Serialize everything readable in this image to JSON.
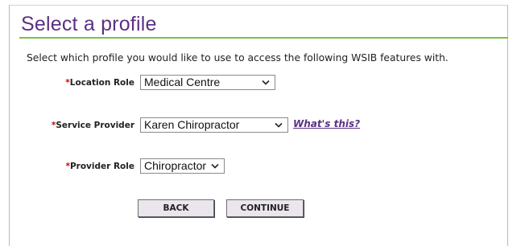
{
  "page": {
    "title": "Select a profile",
    "intro": "Select which profile you would like to use to access the following WSIB features with."
  },
  "fields": {
    "location_role": {
      "label": "Location Role",
      "value": "Medical Centre"
    },
    "service_provider": {
      "label": "Service Provider",
      "value": "Karen Chiropractor"
    },
    "provider_role": {
      "label": "Provider Role",
      "value": "Chiropractor"
    }
  },
  "required_marker": "*",
  "help_link": "What's this?",
  "buttons": {
    "back": "BACK",
    "continue": "CONTINUE"
  },
  "colors": {
    "title": "#5b3185",
    "rule": "#7bc142",
    "required": "#d40000",
    "button_bg": "#ebe6ee"
  },
  "icons": {
    "dropdown": "chevron-down-icon"
  }
}
